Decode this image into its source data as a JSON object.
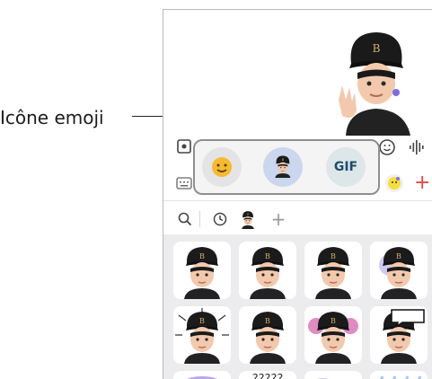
{
  "callout": {
    "label": "Icône emoji"
  },
  "popup": {
    "gif_label": "GIF"
  },
  "subtabs": {
    "add_label": "+"
  },
  "toolbar": {
    "add_label": "+"
  },
  "grid": {
    "question_text": "?????"
  },
  "colors": {
    "accent_add": "#e04a4a",
    "popup_border": "#8f8f8f",
    "avatar_bg": "#cad7ee",
    "gif_text": "#1d4c6e"
  }
}
